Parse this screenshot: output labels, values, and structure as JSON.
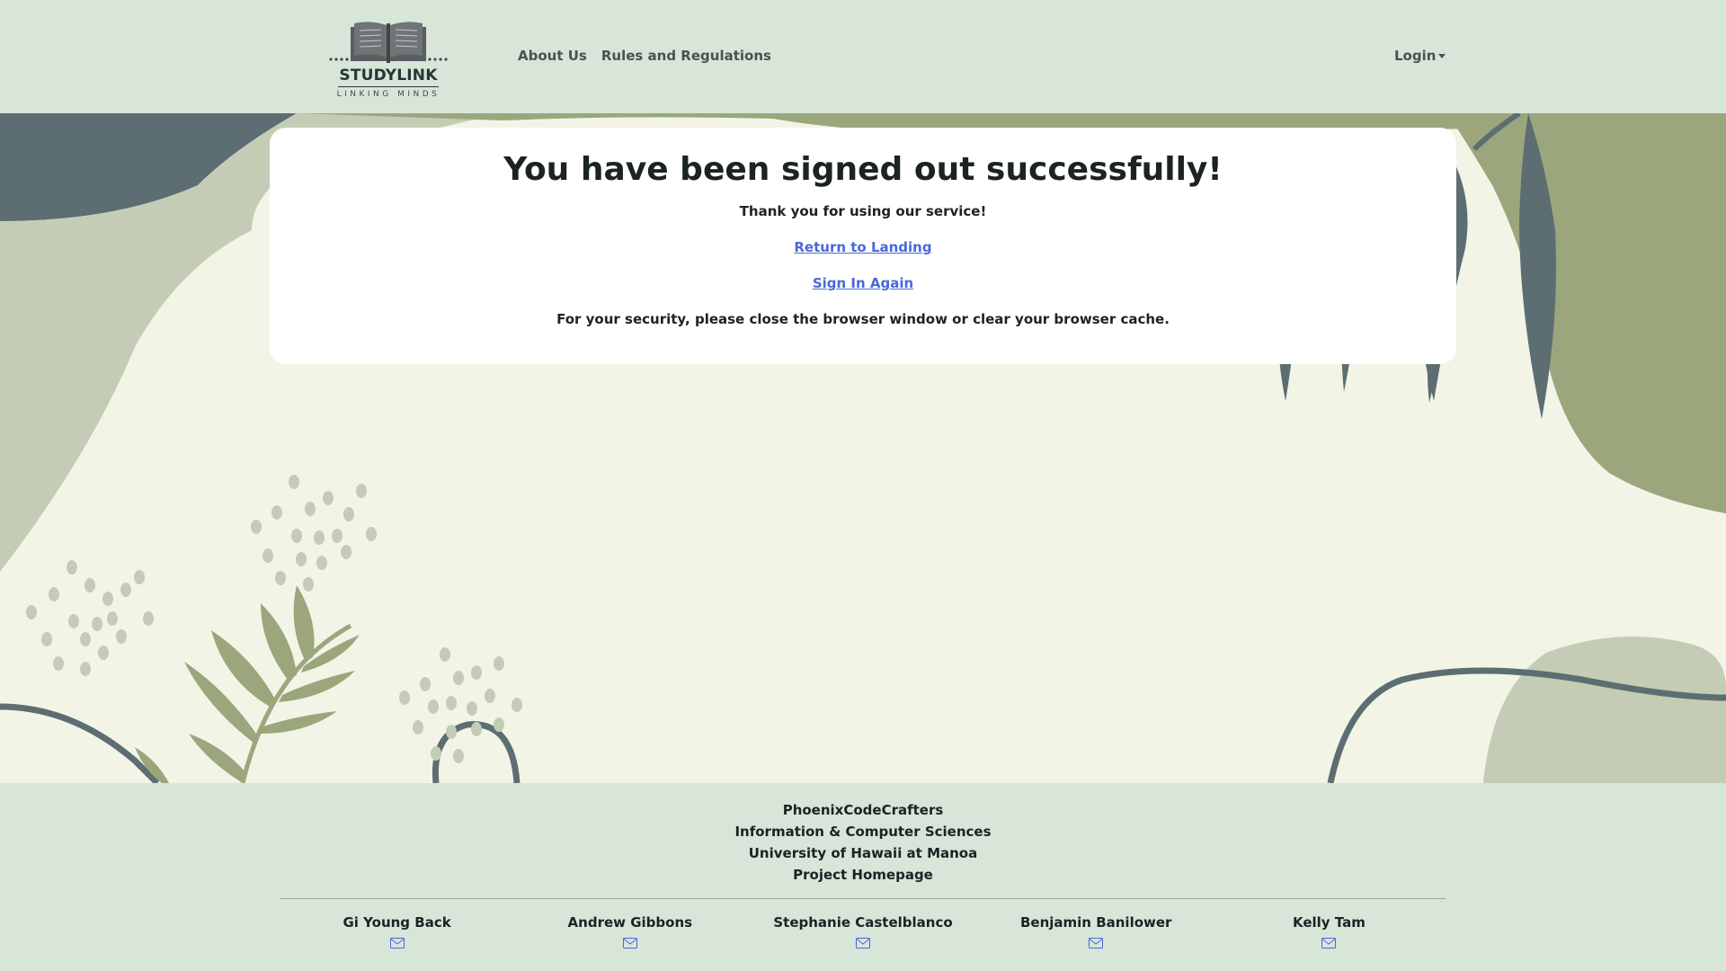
{
  "navbar": {
    "brand_name": "STUDYLINK",
    "brand_tagline": "LINKING MINDS",
    "links": [
      "About Us",
      "Rules and Regulations"
    ],
    "login_label": "Login"
  },
  "card": {
    "title": "You have been signed out successfully!",
    "thanks": "Thank you for using our service!",
    "return_link": "Return to Landing",
    "signin_link": "Sign In Again",
    "security_note": "For your security, please close the browser window or clear your browser cache."
  },
  "footer": {
    "lines": [
      "PhoenixCodeCrafters",
      "Information & Computer Sciences",
      "University of Hawaii at Manoa",
      "Project Homepage"
    ],
    "team": [
      {
        "name": "Gi Young Back"
      },
      {
        "name": "Andrew Gibbons"
      },
      {
        "name": "Stephanie Castelblanco"
      },
      {
        "name": "Benjamin Banilower"
      },
      {
        "name": "Kelly Tam"
      }
    ]
  },
  "colors": {
    "navbar_bg": "#d8e5d9",
    "page_bg": "#f2f4e6",
    "slate": "#5c6e72",
    "sage": "#9ca67d",
    "pale_sage": "#c5ccb6",
    "link": "#4a69d6"
  },
  "icons": {
    "brand": "open-book-icon",
    "mail": "envelope-icon",
    "caret": "caret-down-icon"
  }
}
